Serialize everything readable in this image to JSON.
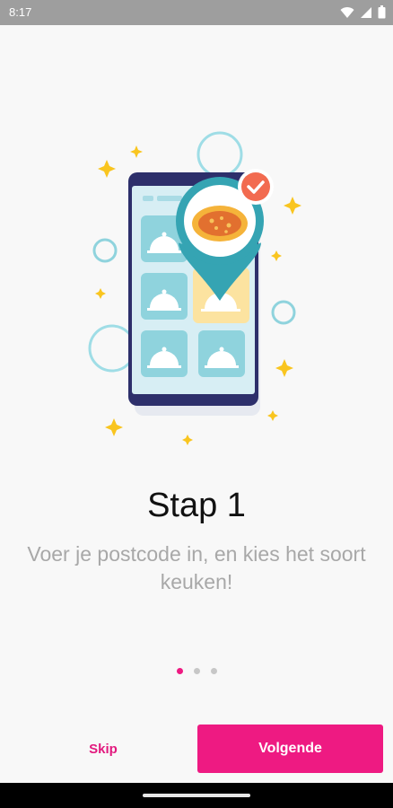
{
  "status_bar": {
    "time": "8:17",
    "icons": [
      "wifi-icon",
      "signal-icon",
      "battery-icon"
    ]
  },
  "illustration": {
    "name": "phone-food-map-illustration",
    "colors": {
      "accent": "#ee1a82",
      "teal": "#35a4b3",
      "yellow": "#f9c51f",
      "phone": "#2d2f6b",
      "check": "#f26b50"
    }
  },
  "onboarding": {
    "title": "Stap 1",
    "subtitle": "Voer je postcode in, en kies het soort keuken!",
    "page_count": 3,
    "current_page": 1
  },
  "actions": {
    "skip_label": "Skip",
    "next_label": "Volgende"
  },
  "colors": {
    "primary": "#ee1a82",
    "background": "#f8f8f8",
    "status_bar": "#9e9e9e",
    "subtitle_text": "#a8a8a8"
  }
}
